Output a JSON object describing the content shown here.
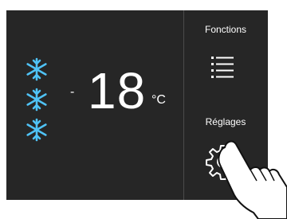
{
  "display": {
    "temperature": {
      "sign": "-",
      "value": "18",
      "unit": "°C"
    },
    "mode_icon": "snowflake-icon",
    "mode_icon_count": 3
  },
  "side_menu": {
    "functions": {
      "label": "Fonctions",
      "icon": "menu-icon"
    },
    "settings": {
      "label": "Réglages",
      "icon": "gear-icon"
    }
  },
  "overlay": {
    "icon": "hand-pointer-icon"
  },
  "colors": {
    "panel_bg": "#262626",
    "snowflake": "#4fc3f7",
    "text": "#ffffff",
    "divider": "#4a4a4a"
  }
}
